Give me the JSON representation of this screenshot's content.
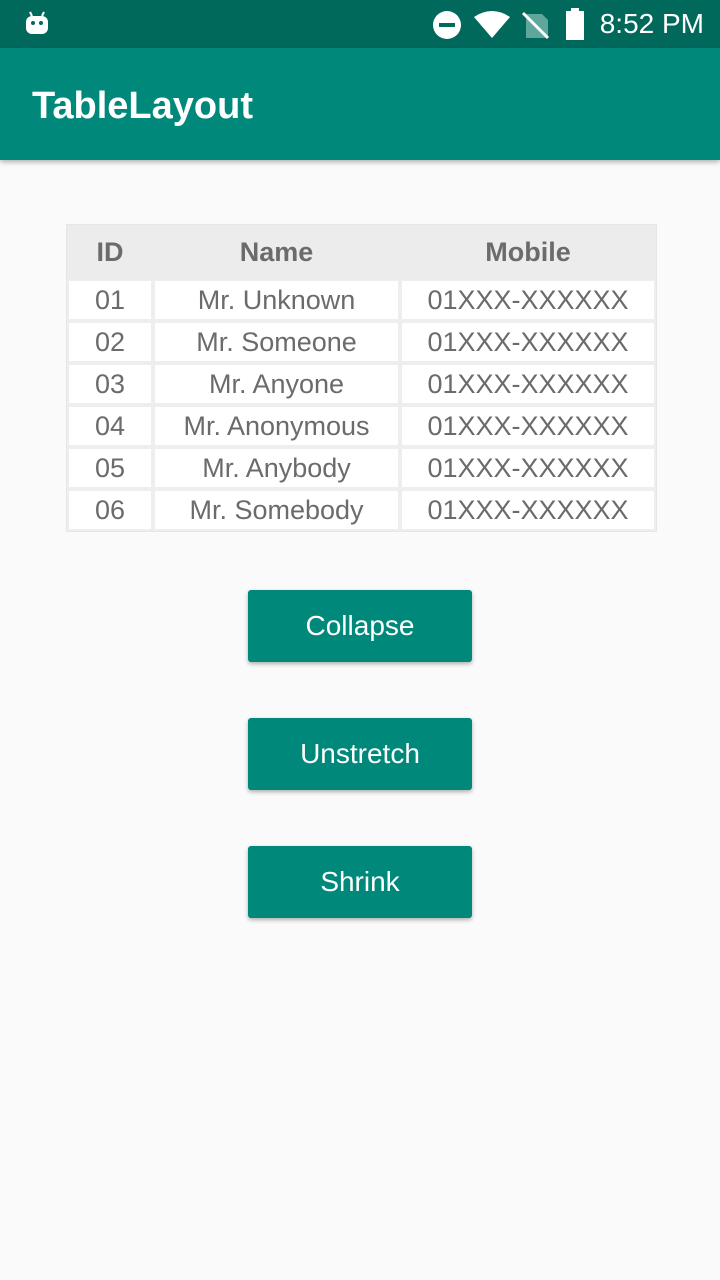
{
  "status_bar": {
    "time": "8:52 PM",
    "icons": [
      "android-icon",
      "do-not-disturb-icon",
      "wifi-icon",
      "no-signal-icon",
      "battery-icon"
    ]
  },
  "app_bar": {
    "title": "TableLayout"
  },
  "table": {
    "headers": [
      "ID",
      "Name",
      "Mobile"
    ],
    "rows": [
      [
        "01",
        "Mr. Unknown",
        "01XXX-XXXXXX"
      ],
      [
        "02",
        "Mr. Someone",
        "01XXX-XXXXXX"
      ],
      [
        "03",
        "Mr. Anyone",
        "01XXX-XXXXXX"
      ],
      [
        "04",
        "Mr. Anonymous",
        "01XXX-XXXXXX"
      ],
      [
        "05",
        "Mr. Anybody",
        "01XXX-XXXXXX"
      ],
      [
        "06",
        "Mr. Somebody",
        "01XXX-XXXXXX"
      ]
    ]
  },
  "buttons": {
    "collapse": "Collapse",
    "unstretch": "Unstretch",
    "shrink": "Shrink"
  },
  "colors": {
    "status_bar": "#00695c",
    "primary": "#00897b",
    "background": "#fafafa"
  }
}
